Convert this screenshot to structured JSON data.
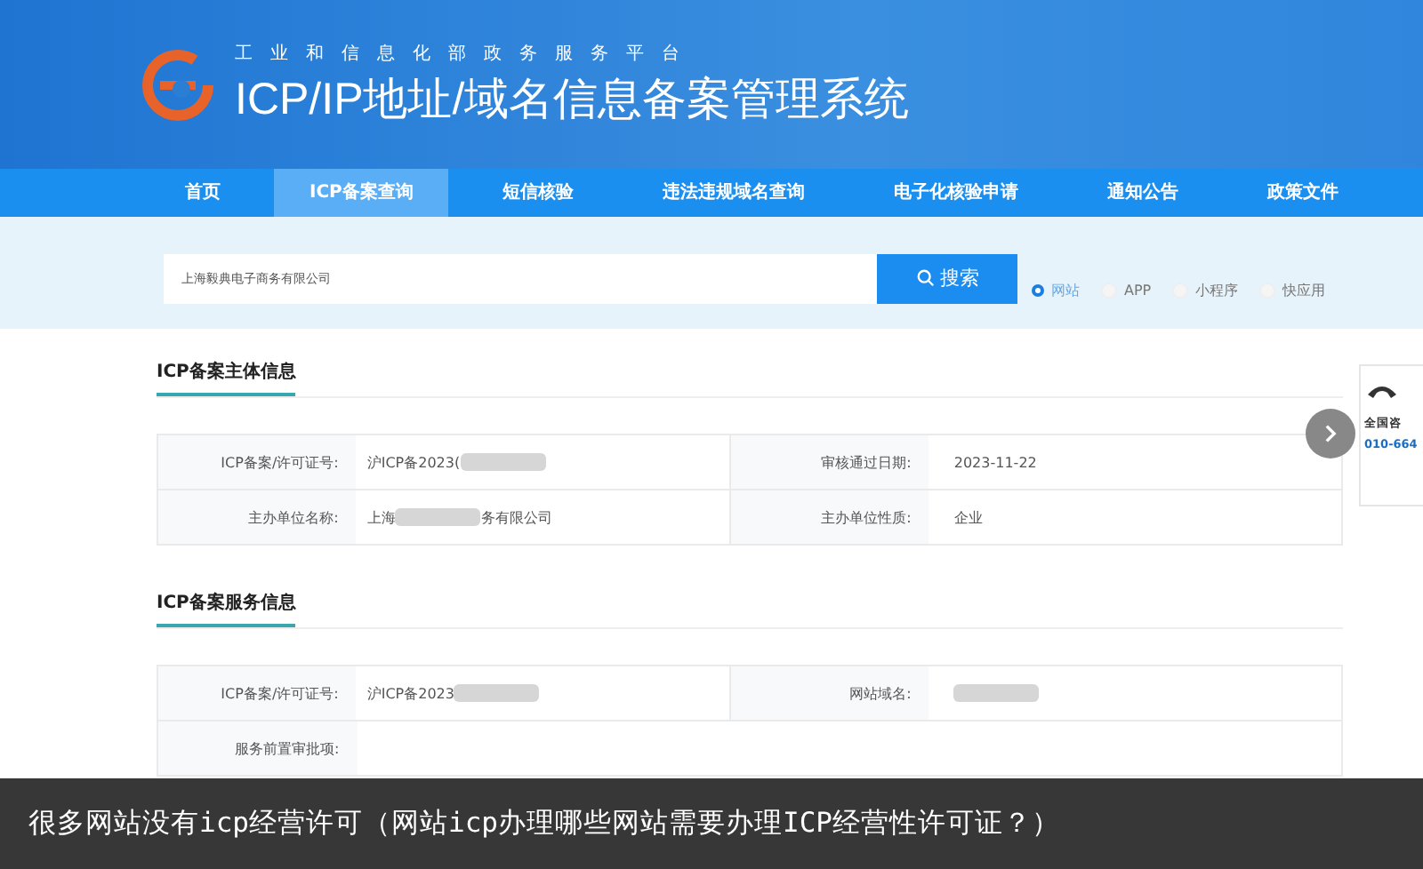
{
  "header": {
    "subtitle": "工业和信息化部政务服务平台",
    "title": "ICP/IP地址/域名信息备案管理系统"
  },
  "nav": [
    {
      "label": "首页",
      "selected": false
    },
    {
      "label": "ICP备案查询",
      "selected": true
    },
    {
      "label": "短信核验",
      "selected": false
    },
    {
      "label": "违法违规域名查询",
      "selected": false
    },
    {
      "label": "电子化核验申请",
      "selected": false
    },
    {
      "label": "通知公告",
      "selected": false
    },
    {
      "label": "政策文件",
      "selected": false
    }
  ],
  "search": {
    "value": "上海毅典电子商务有限公司",
    "button": "搜索"
  },
  "types": [
    {
      "label": "网站",
      "selected": true
    },
    {
      "label": "APP",
      "selected": false
    },
    {
      "label": "小程序",
      "selected": false
    },
    {
      "label": "快应用",
      "selected": false
    }
  ],
  "sections": [
    {
      "title": "ICP备案主体信息",
      "rows": [
        [
          {
            "label": "ICP备案/许可证号:",
            "value": "沪ICP备2023(",
            "redacted": true
          },
          {
            "label": "审核通过日期:",
            "value": "2023-11-22"
          }
        ],
        [
          {
            "label": "主办单位名称:",
            "value": "上海",
            "redacted": true,
            "value_after": "务有限公司"
          },
          {
            "label": "主办单位性质:",
            "value": "企业"
          }
        ]
      ]
    },
    {
      "title": "ICP备案服务信息",
      "rows": [
        [
          {
            "label": "ICP备案/许可证号:",
            "value": "沪ICP备2023",
            "redacted": true
          },
          {
            "label": "网站域名:",
            "redacted": true
          }
        ],
        [
          {
            "label": "服务前置审批项:"
          }
        ]
      ]
    }
  ],
  "side_widget": {
    "label": "全国咨",
    "phone": "010-664"
  },
  "caption": "很多网站没有icp经营许可（网站icp办理哪些网站需要办理ICP经营性许可证？）"
}
